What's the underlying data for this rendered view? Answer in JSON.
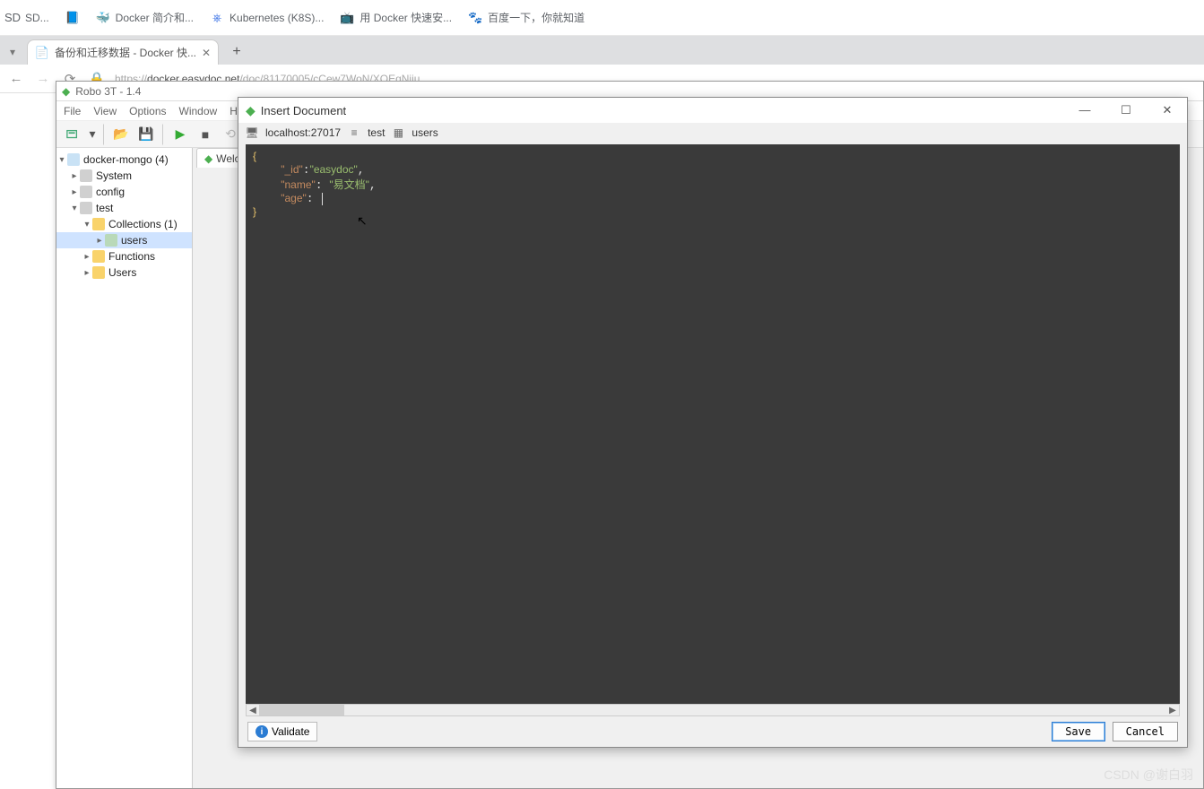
{
  "bookmarks": [
    {
      "icon": "SD",
      "label": "SD..."
    },
    {
      "icon": "📘",
      "label": ""
    },
    {
      "icon": "🐳",
      "label": "Docker 简介和..."
    },
    {
      "icon": "⎈",
      "label": "Kubernetes (K8S)..."
    },
    {
      "icon": "📺",
      "label": "用 Docker 快速安..."
    },
    {
      "icon": "🐾",
      "label": "百度一下，你就知道"
    }
  ],
  "browser": {
    "tab_title": "备份和迁移数据 - Docker 快...",
    "url_prefix": "https://",
    "url_host": "docker.easydoc.net",
    "url_path": "/doc/81170005/cCew7WoN/XQEqNjiu"
  },
  "robo": {
    "title": "Robo 3T - 1.4",
    "menu": [
      "File",
      "View",
      "Options",
      "Window",
      "Help"
    ],
    "doc_tab": "Welc",
    "tree": {
      "root": {
        "label": "docker-mongo (4)"
      },
      "l1": [
        {
          "label": "System"
        },
        {
          "label": "config"
        },
        {
          "label": "test"
        }
      ],
      "test_children": {
        "collections": {
          "label": "Collections (1)",
          "child": "users"
        },
        "functions": "Functions",
        "users": "Users"
      }
    }
  },
  "dialog": {
    "title": "Insert Document",
    "context": {
      "host": "localhost:27017",
      "db": "test",
      "coll": "users"
    },
    "code_lines": {
      "l1": "{",
      "l2_key": "\"_id\"",
      "l2_val": "\"easydoc\"",
      "l3_key": "\"name\"",
      "l3_val": "\"易文档\"",
      "l4_key": "\"age\"",
      "l5": "}"
    },
    "validate": "Validate",
    "save": "Save",
    "cancel": "Cancel"
  },
  "watermark": "CSDN @谢白羽"
}
